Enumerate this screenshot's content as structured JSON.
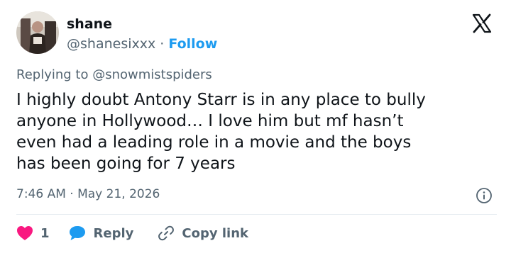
{
  "author": {
    "name": "shane",
    "handle": "@shanesixxx",
    "separator": "·",
    "follow_label": "Follow",
    "avatar_icon": "profile-photo"
  },
  "brand": {
    "logo_icon": "x-logo",
    "color": "#0f1419"
  },
  "tweet": {
    "replying_to": "Replying to @snowmistspiders",
    "text_lines": [
      "I highly doubt Antony Starr is in any place to bully",
      "anyone in Hollywood… I love him but mf hasn’t",
      "even had a leading role in a movie and the boys",
      "has been going for 7 years"
    ],
    "timestamp": "7:46 AM · May 21, 2026",
    "info_icon": "info-icon"
  },
  "actions": {
    "like_count": "1",
    "like_icon": "heart-icon",
    "like_color": "#f91880",
    "reply_label": "Reply",
    "reply_icon": "speech-bubble-icon",
    "reply_color": "#1d9bf0",
    "copy_link_label": "Copy link",
    "copy_icon": "link-icon"
  },
  "colors": {
    "text": "#0f1419",
    "secondary": "#536471",
    "accent": "#1d9bf0"
  }
}
